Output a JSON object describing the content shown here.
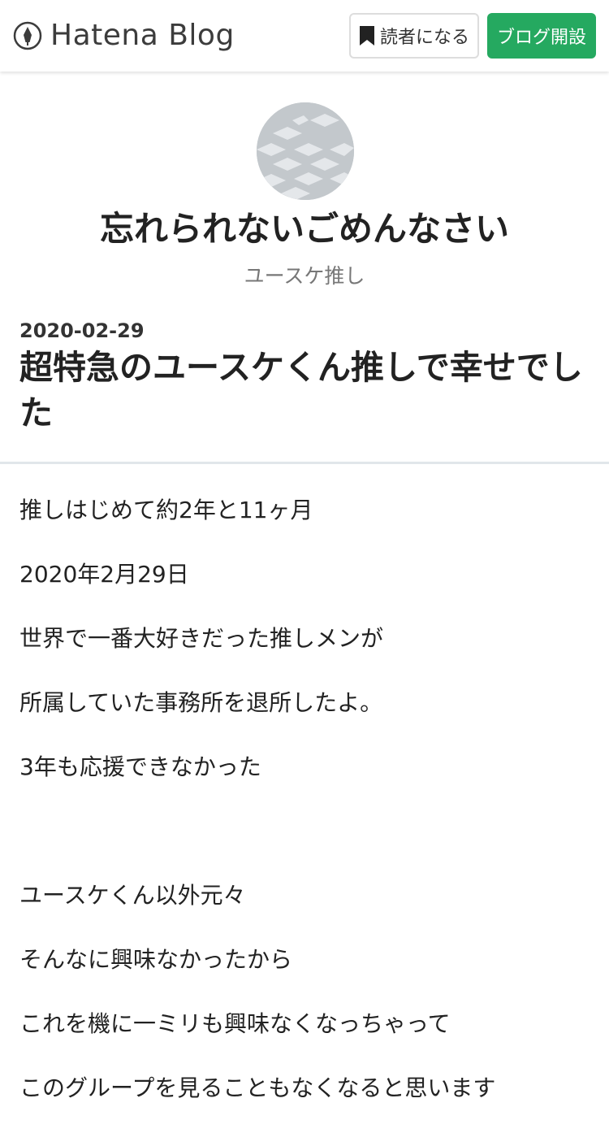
{
  "header": {
    "logo_text": "Hatena Blog",
    "subscribe_label": "読者になる",
    "open_blog_label": "ブログ開設",
    "accent_color": "#25a960"
  },
  "blog": {
    "title": "忘れられないごめんなさい",
    "description": "ユースケ推し"
  },
  "entry": {
    "date": "2020-02-29",
    "title": "超特急のユースケくん推しで幸せでした",
    "paragraphs": [
      "推しはじめて約2年と11ヶ月",
      "2020年2月29日",
      "世界で一番大好きだった推しメンが",
      "所属していた事務所を退所したよ。",
      "3年も応援できなかった",
      "",
      "ユースケくん以外元々",
      "そんなに興味なかったから",
      "これを機に一ミリも興味なくなっちゃって",
      "このグループを見ることもなくなると思います"
    ]
  }
}
